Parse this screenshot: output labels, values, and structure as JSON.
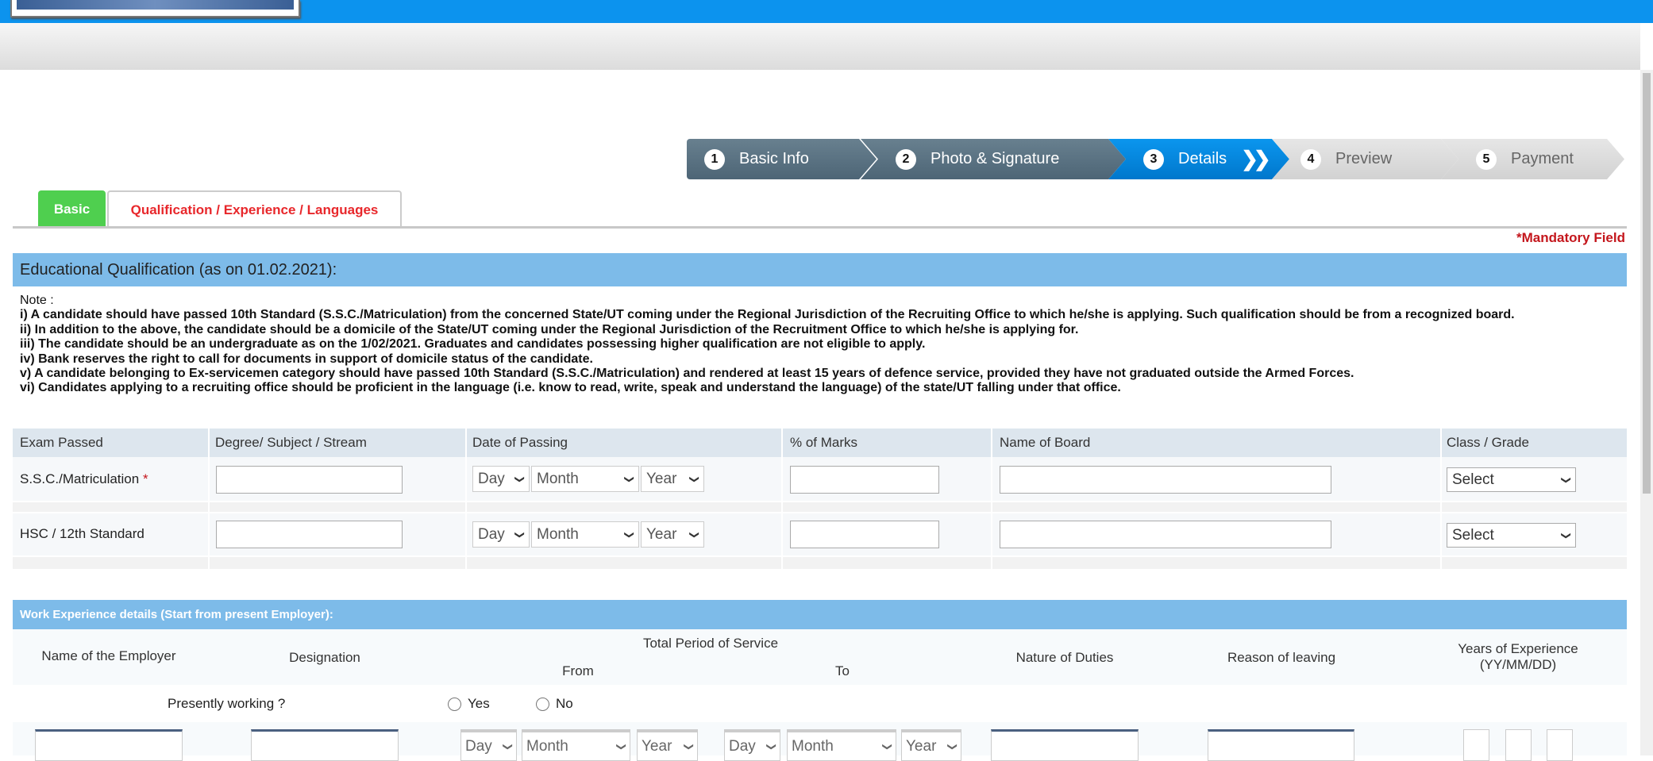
{
  "header": {
    "logo": "recruitment portal logo"
  },
  "steps": [
    {
      "num": "1",
      "label": "Basic Info",
      "state": "done"
    },
    {
      "num": "2",
      "label": "Photo & Signature",
      "state": "done"
    },
    {
      "num": "3",
      "label": "Details",
      "state": "active"
    },
    {
      "num": "4",
      "label": "Preview",
      "state": "pending"
    },
    {
      "num": "5",
      "label": "Payment",
      "state": "pending"
    }
  ],
  "tabs": {
    "basic": "Basic",
    "qualification": "Qualification / Experience / Languages"
  },
  "mandatory": "*Mandatory Field",
  "education": {
    "title": "Educational Qualification (as on 01.02.2021):",
    "note_label": "Note :",
    "notes": [
      "i) A candidate should have passed 10th Standard (S.S.C./Matriculation) from the concerned State/UT coming under the Regional Jurisdiction of the Recruiting Office to which he/she is applying. Such qualification should be from a recognized board.",
      "ii) In addition to the above, the candidate should be a domicile of the State/UT coming under the Regional Jurisdiction of the Recruitment Office to which he/she is applying for.",
      "iii) The candidate should be an undergraduate as on the 1/02/2021. Graduates and candidates possessing higher qualification are not eligible to apply.",
      "iv) Bank reserves the right to call for documents in support of domicile status of the candidate.",
      "v) A candidate belonging to Ex-servicemen category should have passed 10th Standard (S.S.C./Matriculation) and rendered at least 15 years of defence service, provided they have not graduated outside the Armed Forces.",
      "vi) Candidates applying to a recruiting office should be proficient in the language (i.e. know to read, write, speak and understand the language) of the state/UT falling under that office."
    ],
    "columns": [
      "Exam Passed",
      "Degree/ Subject / Stream",
      "Date of Passing",
      "% of Marks",
      "Name of Board",
      "Class / Grade"
    ],
    "rows": [
      {
        "exam": "S.S.C./Matriculation",
        "required": "*",
        "degree": "",
        "day": "Day",
        "month": "Month",
        "year": "Year",
        "marks": "",
        "board": "",
        "grade": "Select"
      },
      {
        "exam": "HSC / 12th Standard",
        "degree": "",
        "day": "Day",
        "month": "Month",
        "year": "Year",
        "marks": "",
        "board": "",
        "grade": "Select"
      }
    ]
  },
  "work": {
    "title": "Work Experience details (Start from present Employer):",
    "columns": {
      "employer": "Name of the Employer",
      "designation": "Designation",
      "period": "Total Period of Service",
      "from": "From",
      "to": "To",
      "duties": "Nature of Duties",
      "reason": "Reason of leaving",
      "years": "Years of Experience",
      "years_format": "(YY/MM/DD)"
    },
    "presently_working": "Presently working ?",
    "yes": "Yes",
    "no": "No",
    "row": {
      "from_day": "Day",
      "from_month": "Month",
      "from_year": "Year",
      "to_day": "Day",
      "to_month": "Month",
      "to_year": "Year"
    }
  }
}
